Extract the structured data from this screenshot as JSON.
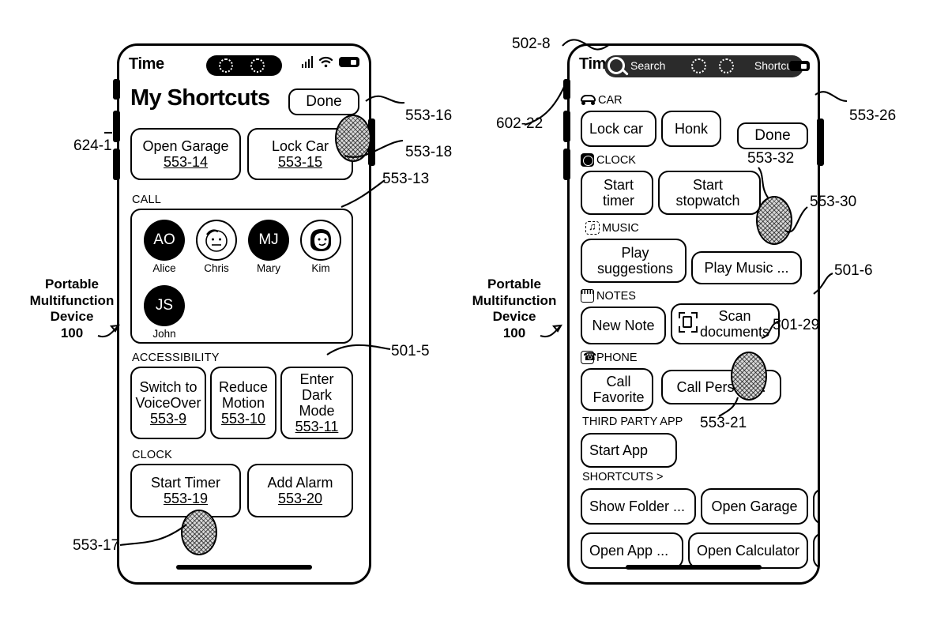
{
  "figure": {
    "device_label_lines": [
      "Portable",
      "Multifunction",
      "Device",
      "100"
    ]
  },
  "left_phone": {
    "status": {
      "time": "Time",
      "cellular_icon": "cellular-bars-icon",
      "wifi_icon": "wifi-icon",
      "battery_icon": "battery-icon"
    },
    "title": "My Shortcuts",
    "done_label": "Done",
    "top_tiles": [
      {
        "label": "Open Garage",
        "ref": "553-14"
      },
      {
        "label": "Lock Car",
        "ref": "553-15"
      }
    ],
    "call_section": {
      "header": "CALL",
      "contacts": [
        {
          "initials": "AO",
          "name": "Alice",
          "style": "dark"
        },
        {
          "initials": "",
          "name": "Chris",
          "style": "light",
          "photo": "face-photo-icon"
        },
        {
          "initials": "MJ",
          "name": "Mary",
          "style": "dark"
        },
        {
          "initials": "",
          "name": "Kim",
          "style": "light",
          "photo": "face-photo-icon"
        },
        {
          "initials": "JS",
          "name": "John",
          "style": "dark"
        }
      ]
    },
    "accessibility_section": {
      "header": "ACCESSIBILITY",
      "tiles": [
        {
          "label": "Switch to VoiceOver",
          "ref": "553-9"
        },
        {
          "label": "Reduce Motion",
          "ref": "553-10"
        },
        {
          "label": "Enter Dark Mode",
          "ref": "553-11"
        }
      ]
    },
    "clock_section": {
      "header": "CLOCK",
      "tiles": [
        {
          "label": "Start Timer",
          "ref": "553-19"
        },
        {
          "label": "Add Alarm",
          "ref": "553-20"
        }
      ]
    },
    "callouts": [
      {
        "id": "624-1",
        "text": "624-1"
      },
      {
        "id": "553-16",
        "text": "553-16"
      },
      {
        "id": "553-18",
        "text": "553-18"
      },
      {
        "id": "553-13",
        "text": "553-13"
      },
      {
        "id": "501-5",
        "text": "501-5"
      },
      {
        "id": "553-17",
        "text": "553-17"
      }
    ]
  },
  "right_phone": {
    "status": {
      "time": "Time",
      "battery_icon": "battery-icon"
    },
    "search": {
      "icon": "search-icon",
      "placeholder": "Search",
      "right_label": "Shortcut"
    },
    "done_label": "Done",
    "sections": [
      {
        "icon": "car-icon",
        "header": "CAR",
        "tiles": [
          {
            "label": "Lock car",
            "align": "left"
          },
          {
            "label": "Honk",
            "align": "center"
          }
        ]
      },
      {
        "icon": "clock-icon",
        "header": "CLOCK",
        "tiles": [
          {
            "label": "Start timer",
            "align": "left"
          },
          {
            "label": "Start stopwatch",
            "align": "right"
          }
        ]
      },
      {
        "icon": "music-icon",
        "header": "MUSIC",
        "tiles": [
          {
            "label": "Play suggestions",
            "align": "left"
          },
          {
            "label": "Play Music ...",
            "align": "center"
          }
        ]
      },
      {
        "icon": "notes-icon",
        "header": "NOTES",
        "tiles": [
          {
            "label": "New Note",
            "align": "center"
          },
          {
            "label": "Scan documents",
            "align": "right",
            "icon": "scan-icon"
          }
        ]
      },
      {
        "icon": "phone-icon",
        "header": "PHONE",
        "tiles": [
          {
            "label": "Call Favorite",
            "align": "left"
          },
          {
            "label": "Call Person ...",
            "align": "center"
          }
        ]
      },
      {
        "icon": "",
        "header": "THIRD PARTY APP",
        "tiles": [
          {
            "label": "Start App",
            "align": "left"
          }
        ]
      },
      {
        "icon": "",
        "header": "SHORTCUTS >",
        "tiles": [
          {
            "label": "Show Folder ...",
            "align": "left"
          },
          {
            "label": "Open Garage",
            "align": "center"
          },
          {
            "label": "Open App ...",
            "align": "left"
          },
          {
            "label": "Open Calculator",
            "align": "center"
          }
        ]
      }
    ],
    "callouts": [
      {
        "id": "502-8",
        "text": "502-8"
      },
      {
        "id": "602-22",
        "text": "602-22"
      },
      {
        "id": "553-26",
        "text": "553-26"
      },
      {
        "id": "553-32",
        "text": "553-32"
      },
      {
        "id": "553-30",
        "text": "553-30"
      },
      {
        "id": "501-6",
        "text": "501-6"
      },
      {
        "id": "501-29",
        "text": "501-29"
      },
      {
        "id": "553-21",
        "text": "553-21"
      }
    ]
  }
}
